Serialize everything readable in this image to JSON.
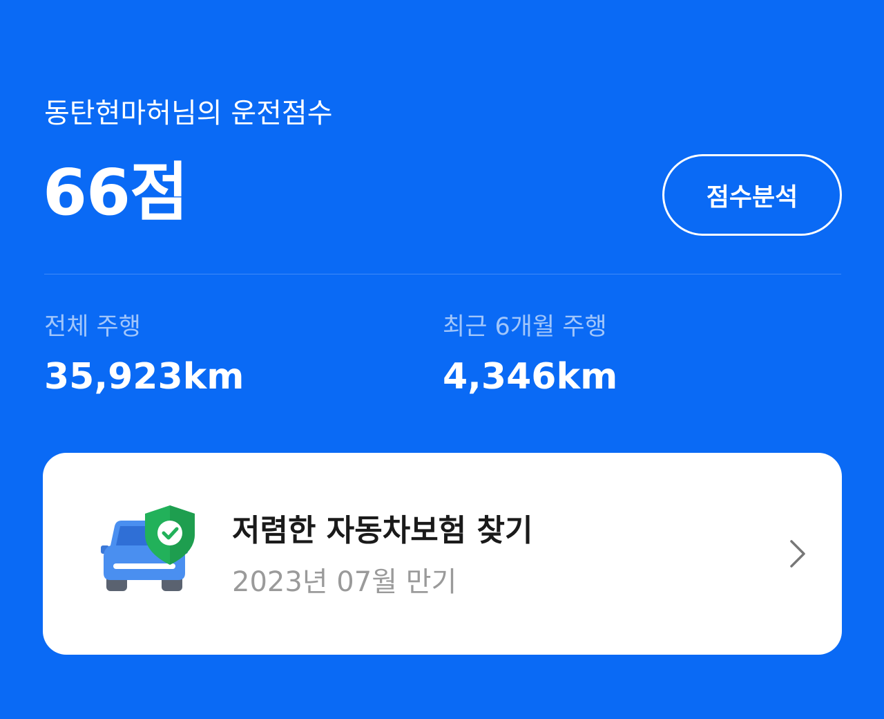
{
  "header": {
    "subtitle": "동탄현마허님의 운전점수",
    "score": "66점",
    "analyze_button": "점수분석"
  },
  "stats": {
    "total": {
      "label": "전체 주행",
      "value": "35,923km"
    },
    "recent": {
      "label": "최근 6개월 주행",
      "value": "4,346km"
    }
  },
  "insurance_card": {
    "title": "저렴한 자동차보험 찾기",
    "subtitle": "2023년 07월 만기",
    "icon": "car-shield-icon",
    "arrow_icon": "chevron-right-icon"
  },
  "colors": {
    "background": "#0a6af5",
    "card": "#ffffff",
    "shield": "#22b15a",
    "car": "#4a8ff0"
  }
}
